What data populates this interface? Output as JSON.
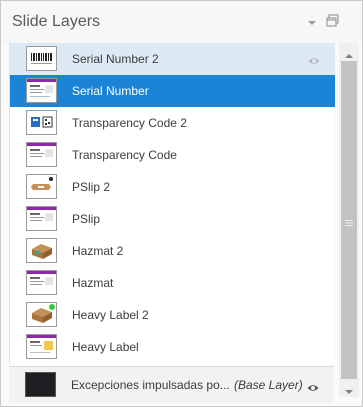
{
  "panel": {
    "title": "Slide Layers",
    "icons": [
      "dropdown-icon",
      "window-restore-icon"
    ]
  },
  "layers": [
    {
      "label": "Serial Number 2",
      "state": "hover",
      "thumb": "barcode",
      "visibility_icon": "eye-icon"
    },
    {
      "label": "Serial Number",
      "state": "selected",
      "thumb": "doc-purple"
    },
    {
      "label": "Transparency Code 2",
      "state": "normal",
      "thumb": "qr-box"
    },
    {
      "label": "Transparency Code",
      "state": "normal",
      "thumb": "doc-purple"
    },
    {
      "label": "PSlip 2",
      "state": "normal",
      "thumb": "slip"
    },
    {
      "label": "PSlip",
      "state": "normal",
      "thumb": "doc-purple"
    },
    {
      "label": "Hazmat 2",
      "state": "normal",
      "thumb": "box-teal"
    },
    {
      "label": "Hazmat",
      "state": "normal",
      "thumb": "doc-purple"
    },
    {
      "label": "Heavy Label 2",
      "state": "normal",
      "thumb": "box-brown"
    },
    {
      "label": "Heavy Label",
      "state": "normal",
      "thumb": "doc-yellow"
    }
  ],
  "base_layer": {
    "label": "Excepciones impulsadas po...",
    "tag": "(Base Layer)",
    "visibility_icon": "eye-icon"
  },
  "colors": {
    "selected": "#1c84d7",
    "hover": "#dde9f5",
    "accent_purple": "#8a2aa8"
  }
}
